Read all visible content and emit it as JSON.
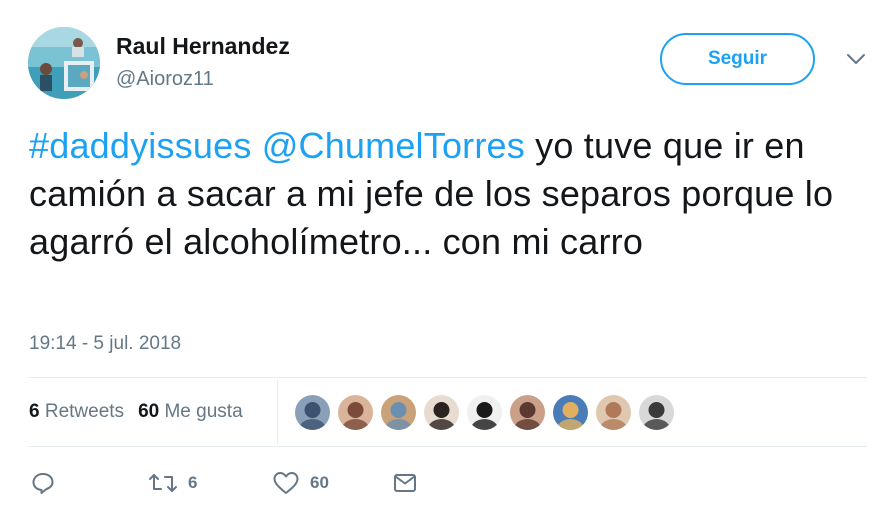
{
  "user": {
    "name": "Raul Hernandez",
    "handle": "@Aioroz11",
    "avatar_icon": "pool-photo-avatar"
  },
  "follow": {
    "label": "Seguir"
  },
  "tweet": {
    "hashtag": "#daddyissues",
    "mention": "@ChumelTorres",
    "body": " yo tuve que ir en camión a sacar a mi jefe de los separos porque lo agarró el alcoholímetro... con mi carro",
    "timestamp": "19:14 - 5 jul. 2018"
  },
  "stats": {
    "retweets_count": "6",
    "retweets_label": "Retweets",
    "likes_count": "60",
    "likes_label": "Me gusta"
  },
  "likers": [
    {
      "icon": "liker-avatar",
      "colors": [
        "#8aa0b8",
        "#3d5270"
      ]
    },
    {
      "icon": "liker-avatar",
      "colors": [
        "#d9b49a",
        "#7a4a3a"
      ]
    },
    {
      "icon": "liker-avatar",
      "colors": [
        "#c9a27a",
        "#6b8fb0"
      ]
    },
    {
      "icon": "liker-avatar",
      "colors": [
        "#e8dcd0",
        "#2a2322"
      ]
    },
    {
      "icon": "liker-avatar",
      "colors": [
        "#f0f0f0",
        "#1a1a1a"
      ]
    },
    {
      "icon": "liker-avatar",
      "colors": [
        "#caa088",
        "#5a3a30"
      ]
    },
    {
      "icon": "liker-avatar",
      "colors": [
        "#4a7db8",
        "#e0b060"
      ]
    },
    {
      "icon": "liker-avatar",
      "colors": [
        "#e0c8b0",
        "#b07a5a"
      ]
    },
    {
      "icon": "liker-avatar",
      "colors": [
        "#d8d8d8",
        "#3a3a3a"
      ]
    }
  ],
  "actions": {
    "reply_icon": "reply-icon",
    "retweet_icon": "retweet-icon",
    "retweet_count": "6",
    "like_icon": "heart-icon",
    "like_count": "60",
    "message_icon": "envelope-icon"
  },
  "colors": {
    "link": "#1da1f2",
    "text": "#14171a",
    "secondary": "#657786",
    "border": "#e6ecf0"
  }
}
